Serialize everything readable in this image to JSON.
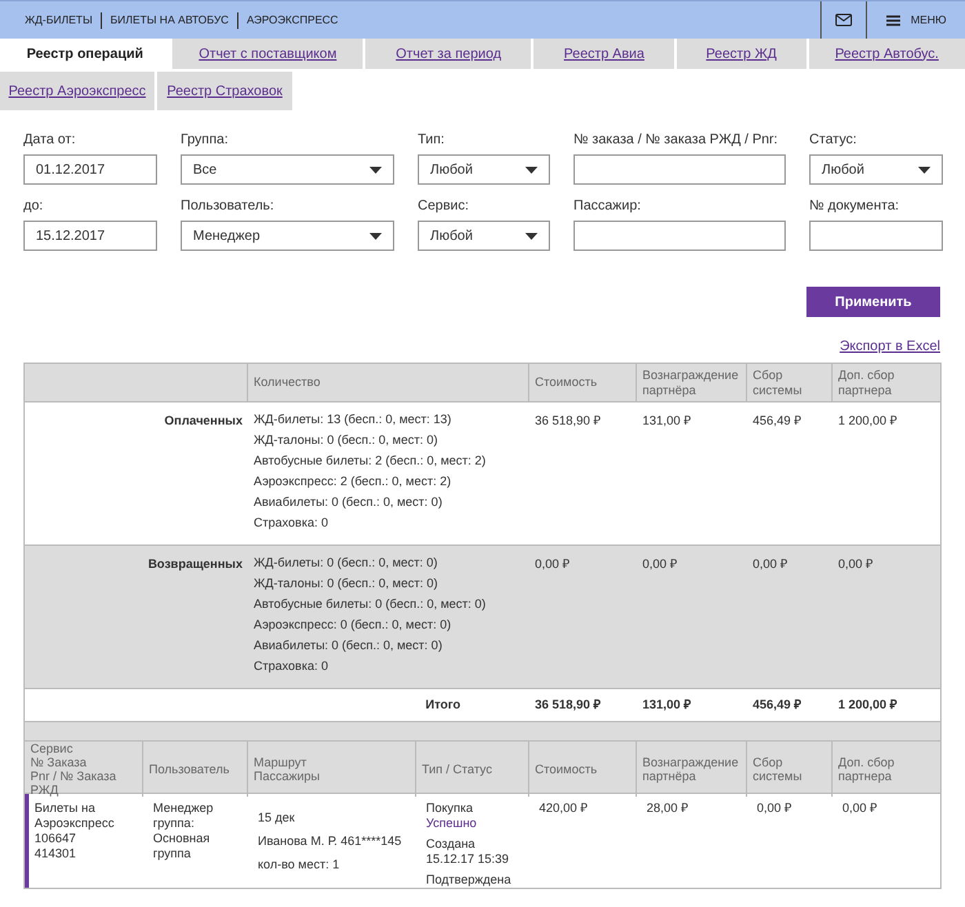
{
  "top_nav": {
    "links": [
      "ЖД-БИЛЕТЫ",
      "БИЛЕТЫ НА АВТОБУС",
      "АЭРОЭКСПРЕСС"
    ],
    "menu_label": "МЕНЮ"
  },
  "tabs": [
    {
      "label": "Реестр операций",
      "selected": true
    },
    {
      "label": "Отчет с поставщиком",
      "selected": false
    },
    {
      "label": "Отчет за период",
      "selected": false
    },
    {
      "label": "Реестр Авиа",
      "selected": false
    },
    {
      "label": "Реестр ЖД",
      "selected": false
    },
    {
      "label": "Реестр Автобус.",
      "selected": false
    },
    {
      "label": "Реестр Аэроэкспресс",
      "selected": false
    },
    {
      "label": "Реестр Страховок",
      "selected": false
    }
  ],
  "filters": [
    {
      "label": "Дата от:",
      "kind": "text",
      "value": "01.12.2017"
    },
    {
      "label": "Группа:",
      "kind": "select",
      "value": "Все"
    },
    {
      "label": "Тип:",
      "kind": "select",
      "value": "Любой"
    },
    {
      "label": "№ заказа / № заказа РЖД / Pnr:",
      "kind": "text"
    },
    {
      "label": "Статус:",
      "kind": "select",
      "value": "Любой"
    },
    {
      "label": "до:",
      "kind": "text",
      "value": "15.12.2017"
    },
    {
      "label": "Пользователь:",
      "kind": "select",
      "value": "Менеджер"
    },
    {
      "label": "Сервис:",
      "kind": "select",
      "value": "Любой"
    },
    {
      "label": "Пассажир:",
      "kind": "text"
    },
    {
      "label": "№ документа:",
      "kind": "text"
    }
  ],
  "apply_button": "Применить",
  "export_link": "Экспорт в Excel",
  "summary": {
    "columns": [
      "Количество",
      "Стоимость",
      "Вознаграждение партнёра",
      "Сбор системы",
      "Доп. сбор партнера"
    ],
    "rows": [
      {
        "label": "Оплаченных",
        "shaded": false,
        "items": [
          "ЖД-билеты: 13 (бесп.: 0, мест: 13)",
          "ЖД-талоны: 0 (бесп.: 0, мест: 0)",
          "Автобусные билеты: 2 (бесп.: 0, мест: 2)",
          "Аэроэкспресс: 2 (бесп.: 0, мест: 2)",
          "Авиабилеты: 0 (бесп.: 0, мест: 0)",
          "Страховка: 0"
        ],
        "values": [
          "36 518,90 ₽",
          "131,00 ₽",
          "456,49 ₽",
          "1 200,00 ₽"
        ]
      },
      {
        "label": "Возвращенных",
        "shaded": true,
        "items": [
          "ЖД-билеты: 0 (бесп.: 0, мест: 0)",
          "ЖД-талоны: 0 (бесп.: 0, мест: 0)",
          "Автобусные билеты: 0 (бесп.: 0, мест: 0)",
          "Аэроэкспресс: 0 (бесп.: 0, мест: 0)",
          "Авиабилеты: 0 (бесп.: 0, мест: 0)",
          "Страховка: 0"
        ],
        "values": [
          "0,00 ₽",
          "0,00 ₽",
          "0,00 ₽",
          "0,00 ₽"
        ]
      }
    ],
    "total": {
      "label": "Итого",
      "values": [
        "36 518,90 ₽",
        "131,00 ₽",
        "456,49 ₽",
        "1 200,00 ₽"
      ]
    }
  },
  "orders": {
    "columns": [
      "Сервис\n№ Заказа\nPnr / № Заказа РЖД",
      "Пользователь",
      "Маршрут\nПассажиры",
      "Тип / Статус",
      "Стоимость",
      "Вознаграждение партнёра",
      "Сбор системы",
      "Доп. сбор партнера"
    ],
    "rows": [
      {
        "service": "Билеты на Аэроэкспресс\n106647\n414301",
        "user": "Менеджер\nгруппа: Основная группа",
        "route": [
          "15 дек",
          "Иванова М. Р. 461****145",
          "кол-во мест: 1"
        ],
        "type": "Покупка",
        "status": "Успешно",
        "events": [
          "Создана\n15.12.17 15:39",
          "Подтверждена"
        ],
        "values": [
          "420,00 ₽",
          "28,00 ₽",
          "0,00 ₽",
          "0,00 ₽"
        ]
      }
    ]
  }
}
